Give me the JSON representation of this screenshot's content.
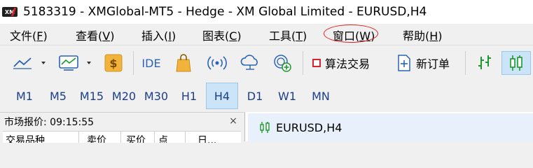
{
  "window": {
    "title": "5183319 - XMGlobal-MT5 - Hedge - XM Global Limited - EURUSD,H4",
    "logo_text": "XM"
  },
  "menubar": {
    "items": [
      {
        "label": "文件(",
        "key": "F",
        "suffix": ")"
      },
      {
        "label": "查看(",
        "key": "V",
        "suffix": ")"
      },
      {
        "label": "插入(",
        "key": "I",
        "suffix": ")"
      },
      {
        "label": "图表(",
        "key": "C",
        "suffix": ")"
      },
      {
        "label": "工具(",
        "key": "T",
        "suffix": ")"
      },
      {
        "label": "窗口(",
        "key": "W",
        "suffix": ")"
      },
      {
        "label": "帮助(",
        "key": "H",
        "suffix": ")"
      }
    ],
    "highlighted_item": "窗口(W)"
  },
  "toolbar": {
    "ide_label": "IDE",
    "algo_trading_label": "算法交易",
    "new_order_label": "新订单",
    "colors": {
      "accent_blue": "#2a64b4",
      "dollar_gold": "#f2b33d",
      "green": "#1a9a2a",
      "red_stop": "#d8242a"
    }
  },
  "timeframes": {
    "items": [
      "M1",
      "M5",
      "M15",
      "M20",
      "M30",
      "H1",
      "H4",
      "D1",
      "W1",
      "MN"
    ],
    "active": "H4"
  },
  "market_watch": {
    "title": "市场报价: 09:15:55",
    "close_symbol": "×",
    "columns": [
      "交易品种",
      "卖价",
      "买价",
      "点",
      "日..."
    ]
  },
  "chart": {
    "tab_label": "EURUSD,H4"
  }
}
